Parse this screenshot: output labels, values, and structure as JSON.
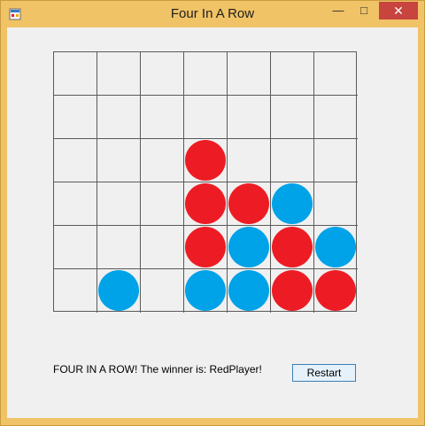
{
  "window": {
    "title": "Four In A Row",
    "controls": {
      "minimize": "—",
      "maximize": "□",
      "close": "✕"
    }
  },
  "board": {
    "columns": 7,
    "rows": 6,
    "colors": {
      "red": "#ed1c24",
      "blue": "#00a2e8"
    },
    "cells": [
      [
        null,
        null,
        null,
        null,
        null,
        null,
        null
      ],
      [
        null,
        null,
        null,
        null,
        null,
        null,
        null
      ],
      [
        null,
        null,
        null,
        "red",
        null,
        null,
        null
      ],
      [
        null,
        null,
        null,
        "red",
        "red",
        "blue",
        null
      ],
      [
        null,
        null,
        null,
        "red",
        "blue",
        "red",
        "blue"
      ],
      [
        null,
        "blue",
        null,
        "blue",
        "blue",
        "red",
        "red"
      ]
    ]
  },
  "status": {
    "text": "FOUR IN A ROW! The winner is: RedPlayer!"
  },
  "actions": {
    "restart_label": "Restart"
  }
}
